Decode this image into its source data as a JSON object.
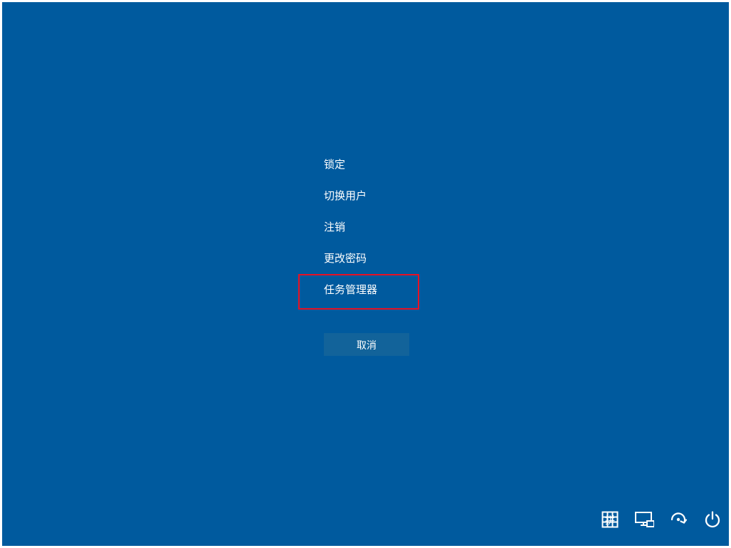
{
  "options": {
    "lock": "锁定",
    "switch_user": "切换用户",
    "sign_out": "注销",
    "change_password": "更改密码",
    "task_manager": "任务管理器"
  },
  "cancel_label": "取消",
  "highlight": "task_manager",
  "tray": {
    "ime": "拼",
    "network": "network",
    "ease_of_access": "ease-of-access",
    "power": "power"
  }
}
